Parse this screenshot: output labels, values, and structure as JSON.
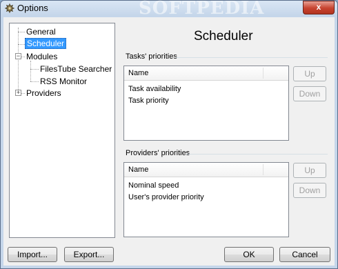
{
  "window": {
    "title": "Options",
    "watermark": "SOFTPEDIA",
    "close_glyph": "x"
  },
  "tree": {
    "items": [
      {
        "label": "General"
      },
      {
        "label": "Scheduler",
        "selected": true
      },
      {
        "label": "Modules"
      },
      {
        "label": "FilesTube Searcher"
      },
      {
        "label": "RSS Monitor"
      },
      {
        "label": "Providers"
      }
    ],
    "expand_glyphs": {
      "modules": "−",
      "providers": "+"
    }
  },
  "page": {
    "heading": "Scheduler",
    "tasks": {
      "group_label": "Tasks' priorities",
      "column_header": "Name",
      "rows": [
        "Task availability",
        "Task priority"
      ],
      "up_label": "Up",
      "down_label": "Down"
    },
    "providers": {
      "group_label": "Providers' priorities",
      "column_header": "Name",
      "rows": [
        "Nominal speed",
        "User's provider priority"
      ],
      "up_label": "Up",
      "down_label": "Down"
    },
    "watermark": "SOFTPEDIA"
  },
  "footer": {
    "import_label": "Import...",
    "export_label": "Export...",
    "ok_label": "OK",
    "cancel_label": "Cancel"
  },
  "colors": {
    "selection": "#3399ff",
    "close_button": "#c7432f",
    "title_gradient_top": "#d9e6f4"
  },
  "icons": {
    "app": "options-gear-icon",
    "close": "close-icon",
    "expander": "tree-expander-icon"
  }
}
